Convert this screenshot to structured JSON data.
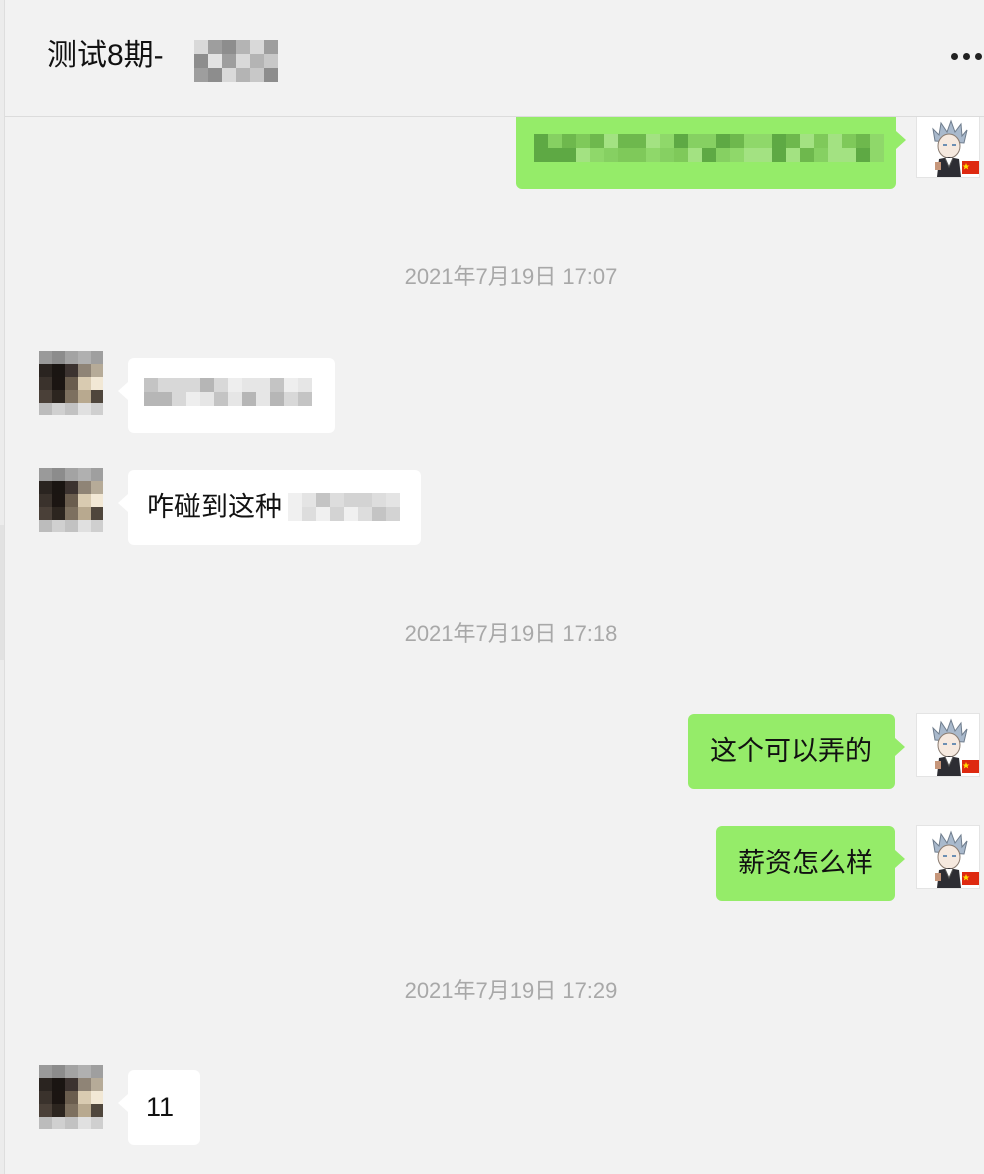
{
  "header": {
    "title": "测试8期-",
    "more_icon": "more-horizontal-icon"
  },
  "messages": [
    {
      "type": "text",
      "direction": "out",
      "sender": "self",
      "text": "",
      "redacted": true
    },
    {
      "type": "time",
      "text": "2021年7月19日 17:07"
    },
    {
      "type": "text",
      "direction": "in",
      "sender": "contact",
      "text": "",
      "redacted": true
    },
    {
      "type": "text",
      "direction": "in",
      "sender": "contact",
      "text": "咋碰到这种",
      "redacted_suffix": true
    },
    {
      "type": "time",
      "text": "2021年7月19日 17:18"
    },
    {
      "type": "text",
      "direction": "out",
      "sender": "self",
      "text": "这个可以弄的"
    },
    {
      "type": "text",
      "direction": "out",
      "sender": "self",
      "text": "薪资怎么样"
    },
    {
      "type": "time",
      "text": "2021年7月19日 17:29"
    },
    {
      "type": "text",
      "direction": "in",
      "sender": "contact",
      "text": "11"
    }
  ],
  "colors": {
    "background": "#f2f2f2",
    "outgoing_bubble": "#95ec69",
    "incoming_bubble": "#ffffff",
    "timestamp_text": "#a8a8a8"
  }
}
